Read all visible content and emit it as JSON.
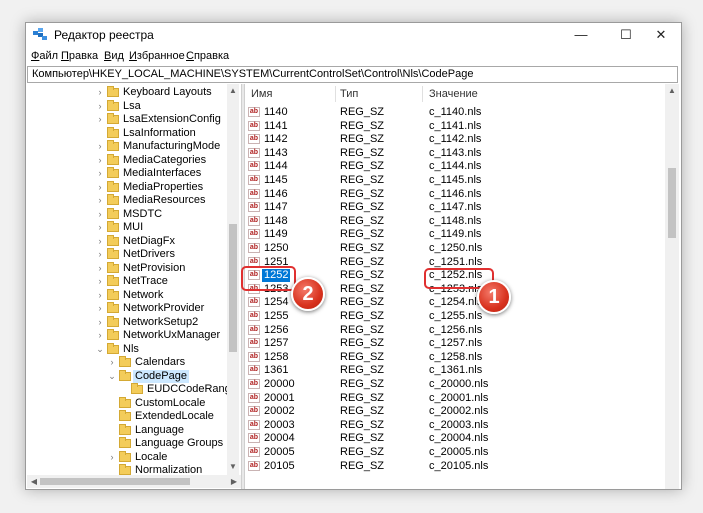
{
  "window": {
    "title": "Редактор реестра",
    "controls": {
      "minimize": "—",
      "maximize": "☐",
      "close": "✕"
    }
  },
  "menu": [
    {
      "accel": "Ф",
      "rest": "айл"
    },
    {
      "accel": "П",
      "rest": "равка"
    },
    {
      "accel": "В",
      "rest": "ид"
    },
    {
      "accel": "И",
      "rest": "збранное"
    },
    {
      "accel": "С",
      "rest": "правка"
    }
  ],
  "address": "Компьютер\\HKEY_LOCAL_MACHINE\\SYSTEM\\CurrentControlSet\\Control\\Nls\\CodePage",
  "tree": [
    {
      "label": "Keyboard Layouts",
      "level": 0,
      "expander": ">"
    },
    {
      "label": "Lsa",
      "level": 0,
      "expander": ">"
    },
    {
      "label": "LsaExtensionConfig",
      "level": 0,
      "expander": ">"
    },
    {
      "label": "LsaInformation",
      "level": 0,
      "expander": ""
    },
    {
      "label": "ManufacturingMode",
      "level": 0,
      "expander": ">"
    },
    {
      "label": "MediaCategories",
      "level": 0,
      "expander": ">"
    },
    {
      "label": "MediaInterfaces",
      "level": 0,
      "expander": ">"
    },
    {
      "label": "MediaProperties",
      "level": 0,
      "expander": ">"
    },
    {
      "label": "MediaResources",
      "level": 0,
      "expander": ">"
    },
    {
      "label": "MSDTC",
      "level": 0,
      "expander": ">"
    },
    {
      "label": "MUI",
      "level": 0,
      "expander": ">"
    },
    {
      "label": "NetDiagFx",
      "level": 0,
      "expander": ">"
    },
    {
      "label": "NetDrivers",
      "level": 0,
      "expander": ">"
    },
    {
      "label": "NetProvision",
      "level": 0,
      "expander": ">"
    },
    {
      "label": "NetTrace",
      "level": 0,
      "expander": ">"
    },
    {
      "label": "Network",
      "level": 0,
      "expander": ">"
    },
    {
      "label": "NetworkProvider",
      "level": 0,
      "expander": ">"
    },
    {
      "label": "NetworkSetup2",
      "level": 0,
      "expander": ">"
    },
    {
      "label": "NetworkUxManager",
      "level": 0,
      "expander": ">"
    },
    {
      "label": "Nls",
      "level": 0,
      "expander": "v"
    },
    {
      "label": "Calendars",
      "level": 1,
      "expander": ">"
    },
    {
      "label": "CodePage",
      "level": 1,
      "expander": "v",
      "selected": true
    },
    {
      "label": "EUDCCodeRange",
      "level": 2,
      "expander": ""
    },
    {
      "label": "CustomLocale",
      "level": 1,
      "expander": ""
    },
    {
      "label": "ExtendedLocale",
      "level": 1,
      "expander": ""
    },
    {
      "label": "Language",
      "level": 1,
      "expander": ""
    },
    {
      "label": "Language Groups",
      "level": 1,
      "expander": ""
    },
    {
      "label": "Locale",
      "level": 1,
      "expander": ">"
    },
    {
      "label": "Normalization",
      "level": 1,
      "expander": ""
    }
  ],
  "list": {
    "headers": {
      "name": "Имя",
      "type": "Тип",
      "value": "Значение"
    },
    "icon_text": "ab",
    "rows": [
      {
        "name": "1140",
        "type": "REG_SZ",
        "value": "c_1140.nls"
      },
      {
        "name": "1141",
        "type": "REG_SZ",
        "value": "c_1141.nls"
      },
      {
        "name": "1142",
        "type": "REG_SZ",
        "value": "c_1142.nls"
      },
      {
        "name": "1143",
        "type": "REG_SZ",
        "value": "c_1143.nls"
      },
      {
        "name": "1144",
        "type": "REG_SZ",
        "value": "c_1144.nls"
      },
      {
        "name": "1145",
        "type": "REG_SZ",
        "value": "c_1145.nls"
      },
      {
        "name": "1146",
        "type": "REG_SZ",
        "value": "c_1146.nls"
      },
      {
        "name": "1147",
        "type": "REG_SZ",
        "value": "c_1147.nls"
      },
      {
        "name": "1148",
        "type": "REG_SZ",
        "value": "c_1148.nls"
      },
      {
        "name": "1149",
        "type": "REG_SZ",
        "value": "c_1149.nls"
      },
      {
        "name": "1250",
        "type": "REG_SZ",
        "value": "c_1250.nls"
      },
      {
        "name": "1251",
        "type": "REG_SZ",
        "value": "c_1251.nls"
      },
      {
        "name": "1252",
        "type": "REG_SZ",
        "value": "c_1252.nls",
        "selected": true
      },
      {
        "name": "1253",
        "type": "REG_SZ",
        "value": "c_1253.nls"
      },
      {
        "name": "1254",
        "type": "REG_SZ",
        "value": "c_1254.nls"
      },
      {
        "name": "1255",
        "type": "REG_SZ",
        "value": "c_1255.nls"
      },
      {
        "name": "1256",
        "type": "REG_SZ",
        "value": "c_1256.nls"
      },
      {
        "name": "1257",
        "type": "REG_SZ",
        "value": "c_1257.nls"
      },
      {
        "name": "1258",
        "type": "REG_SZ",
        "value": "c_1258.nls"
      },
      {
        "name": "1361",
        "type": "REG_SZ",
        "value": "c_1361.nls"
      },
      {
        "name": "20000",
        "type": "REG_SZ",
        "value": "c_20000.nls"
      },
      {
        "name": "20001",
        "type": "REG_SZ",
        "value": "c_20001.nls"
      },
      {
        "name": "20002",
        "type": "REG_SZ",
        "value": "c_20002.nls"
      },
      {
        "name": "20003",
        "type": "REG_SZ",
        "value": "c_20003.nls"
      },
      {
        "name": "20004",
        "type": "REG_SZ",
        "value": "c_20004.nls"
      },
      {
        "name": "20005",
        "type": "REG_SZ",
        "value": "c_20005.nls"
      },
      {
        "name": "20105",
        "type": "REG_SZ",
        "value": "c_20105.nls"
      }
    ]
  },
  "callouts": [
    {
      "label": "1",
      "color": "#d8321e"
    },
    {
      "label": "2",
      "color": "#d8321e"
    }
  ]
}
